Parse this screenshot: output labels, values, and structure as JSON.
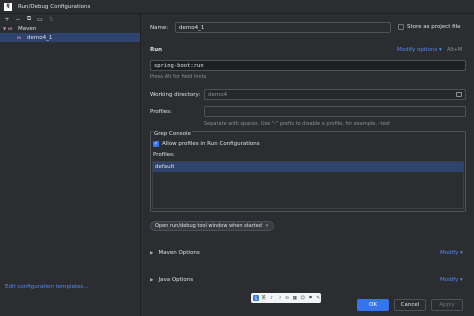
{
  "window": {
    "title": "Run/Debug Configurations",
    "app_icon": "IJ"
  },
  "left": {
    "toolbar": [
      {
        "icon": "add-icon",
        "glyph": "+"
      },
      {
        "icon": "remove-icon",
        "glyph": "−"
      },
      {
        "icon": "copy-icon",
        "glyph": "⧉"
      },
      {
        "icon": "move-into-folder-icon",
        "glyph": "▭"
      },
      {
        "icon": "sort-icon",
        "glyph": "⇅"
      }
    ],
    "tree": {
      "root_label": "Maven",
      "child_label": "demo4_1",
      "maven_badge": "m"
    },
    "edit_templates": "Edit configuration templates..."
  },
  "form": {
    "name_label": "Name:",
    "name_value": "demo4_1",
    "store_label": "Store as project file",
    "run_section": "Run",
    "modify_options": "Modify options",
    "modify_shortcut": "Alt+M",
    "command_value": "spring-boot:run",
    "command_hint": "Press Alt for field hints",
    "working_dir_label": "Working directory:",
    "working_dir_value": "demo4",
    "profiles_label": "Profiles:",
    "profiles_hint": "Separate with spaces. Use \"-\" prefix to disable a profile, for example, -test"
  },
  "grep": {
    "title": "Grep Console",
    "allow_label": "Allow profiles in Run Configurations",
    "profiles_label": "Profiles:",
    "profile_item": "default"
  },
  "options": {
    "tag": "Open run/debug tool window when started",
    "maven_options": "Maven Options",
    "java_options": "Java Options",
    "modify_label": "Modify"
  },
  "ime": {
    "logo": "S",
    "items": [
      "英",
      "♪",
      "☽",
      "⊙",
      "▦",
      "☺",
      "⚑",
      "✎"
    ]
  },
  "buttons": {
    "help": "?",
    "ok": "OK",
    "cancel": "Cancel",
    "apply": "Apply"
  }
}
